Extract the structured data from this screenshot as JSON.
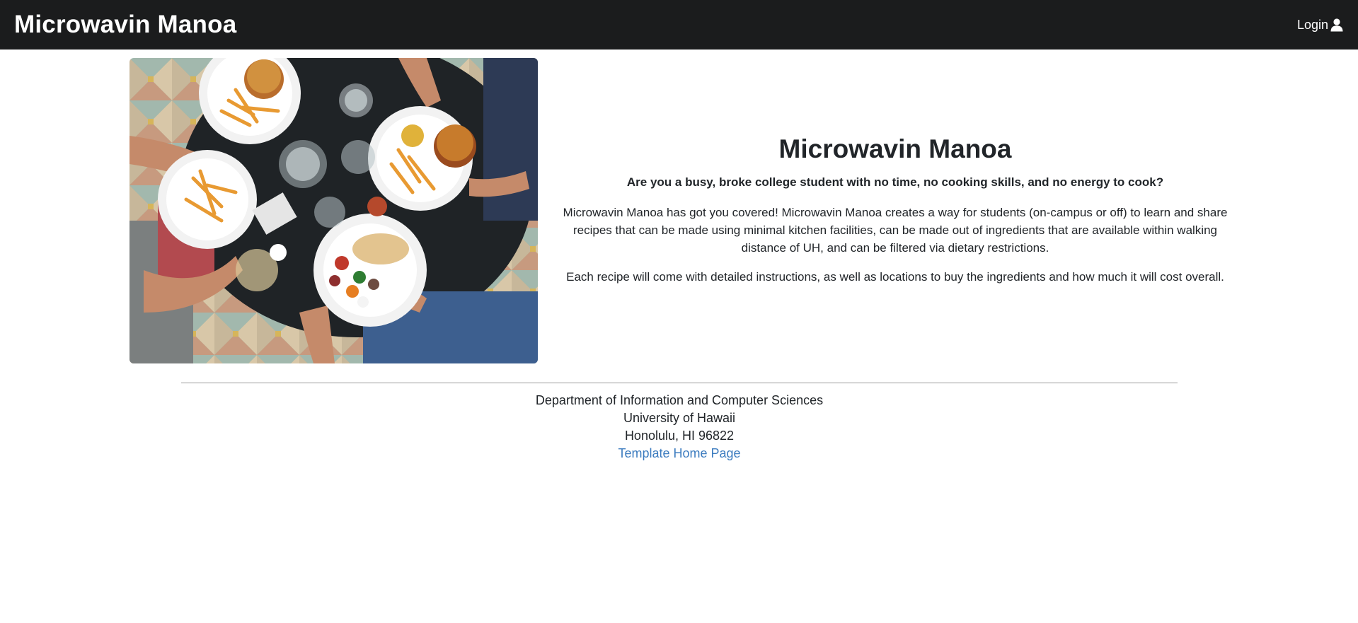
{
  "navbar": {
    "brand": "Microwavin Manoa",
    "login_label": "Login",
    "login_icon": "user-icon"
  },
  "hero": {
    "image_icon": "food-table-photo",
    "title": "Microwavin Manoa",
    "lead": "Are you a busy, broke college student with no time, no cooking skills, and no energy to cook?",
    "paragraph1": "Microwavin Manoa has got you covered! Microwavin Manoa creates a way for students (on-campus or off) to learn and share recipes that can be made using minimal kitchen facilities, can be made out of ingredients that are available within walking distance of UH, and can be filtered via dietary restrictions.",
    "paragraph2": "Each recipe will come with detailed instructions, as well as locations to buy the ingredients and how much it will cost overall."
  },
  "footer": {
    "line1": "Department of Information and Computer Sciences",
    "line2": "University of Hawaii",
    "line3": "Honolulu, HI 96822",
    "link_label": "Template Home Page"
  },
  "colors": {
    "navbar_bg": "#1b1c1d",
    "link": "#3b7bbf"
  }
}
